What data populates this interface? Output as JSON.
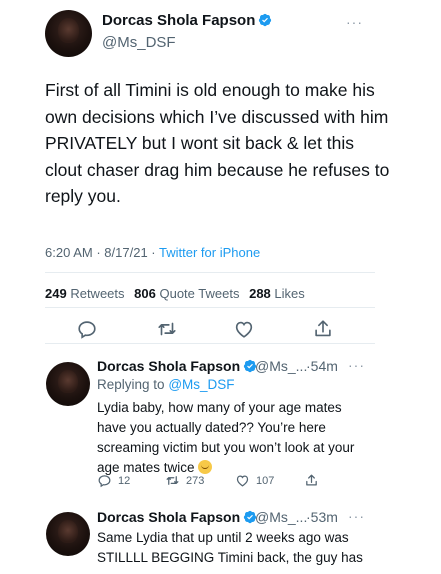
{
  "main_tweet": {
    "author_name": "Dorcas Shola Fapson",
    "author_handle": "@Ms_DSF",
    "text": "First of all Timini is old enough to make his own decisions which I’ve discussed with him PRIVATELY but I wont sit back & let this clout chaser drag him because he refuses to reply you.",
    "time": "6:20 AM",
    "date": "8/17/21",
    "source": "Twitter for iPhone",
    "stats": {
      "retweets_count": "249",
      "retweets_label": "Retweets",
      "quotes_count": "806",
      "quotes_label": "Quote Tweets",
      "likes_count": "288",
      "likes_label": "Likes"
    }
  },
  "replies": [
    {
      "author_name": "Dorcas Shola Fapson",
      "author_handle": "@Ms_...",
      "time": "·54m",
      "replying_prefix": "Replying to",
      "replying_to": "@Ms_DSF",
      "text": "Lydia baby, how many of your age mates have you actually dated?? You’re here screaming victim but you won’t look at your age mates twice",
      "emoji": "face-with-open-mouth",
      "reply_count": "12",
      "retweet_count": "273",
      "like_count": "107"
    },
    {
      "author_name": "Dorcas Shola Fapson",
      "author_handle": "@Ms_...",
      "time": "·53m",
      "text": "Same Lydia that up until 2 weeks ago was STILLLL BEGGING Timini back, the guy has"
    }
  ],
  "icons": {
    "verified_color": "#1d9bf0",
    "reply": "reply-icon",
    "retweet": "retweet-icon",
    "like": "like-icon",
    "share": "share-icon",
    "more": "more-icon"
  }
}
